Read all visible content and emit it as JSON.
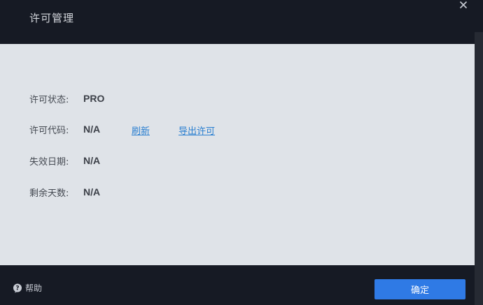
{
  "dialog": {
    "title": "许可管理",
    "close_icon": "close-icon"
  },
  "license": {
    "status_label": "许可状态:",
    "status_value": "PRO",
    "code_label": "许可代码:",
    "code_value": "N/A",
    "refresh_link": "刷新",
    "export_link": "导出许可",
    "expiry_label": "失效日期:",
    "expiry_value": "N/A",
    "days_label": "剩余天数:",
    "days_value": "N/A"
  },
  "footer": {
    "help_label": "帮助",
    "help_icon": "help-icon",
    "ok_label": "确定"
  },
  "colors": {
    "accent": "#2f7ae5",
    "link": "#2a7fd0",
    "panel_bg": "#dfe3e8",
    "frame_bg": "#161a24"
  }
}
